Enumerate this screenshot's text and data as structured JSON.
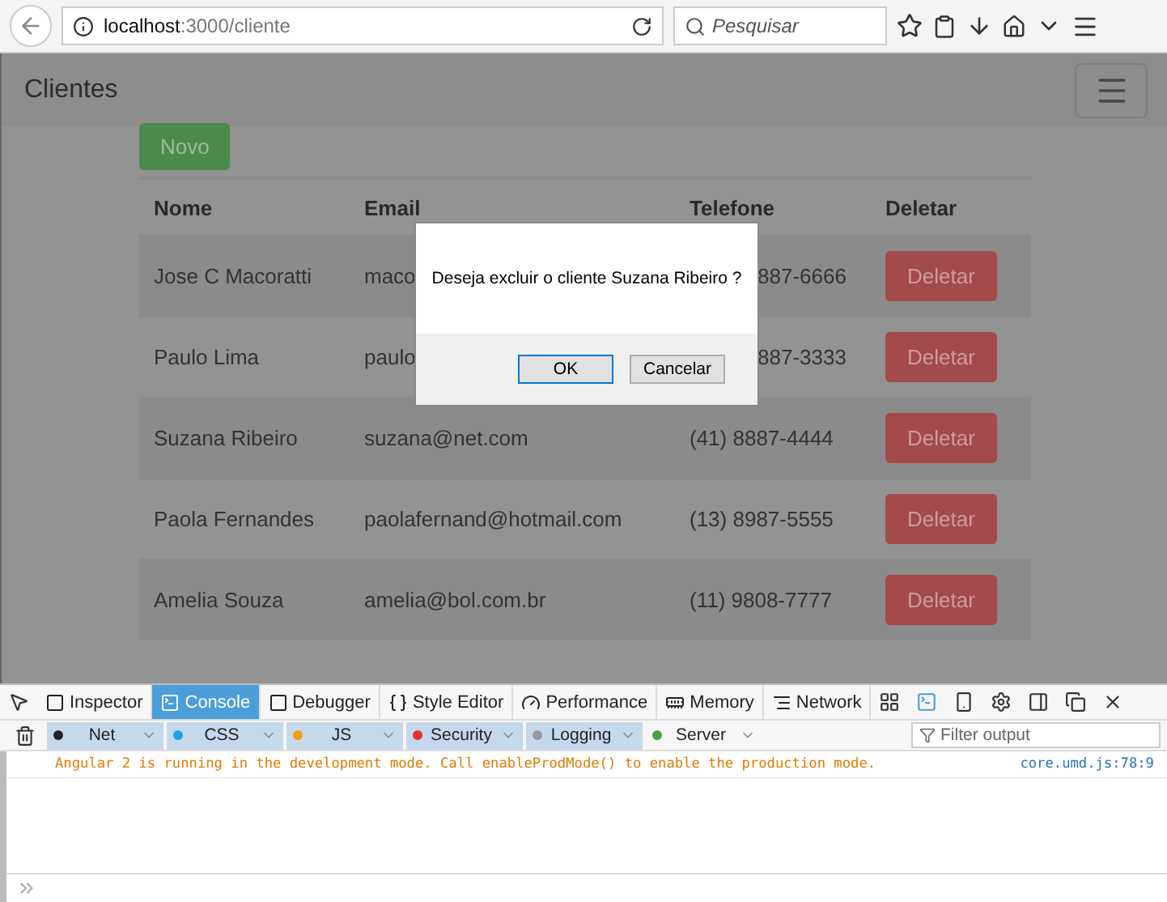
{
  "browser": {
    "url_host": "localhost",
    "url_path": ":3000/cliente",
    "search_placeholder": "Pesquisar"
  },
  "page": {
    "brand": "Clientes",
    "new_button": "Novo",
    "columns": [
      "Nome",
      "Email",
      "Telefone",
      "Deletar"
    ],
    "rows": [
      {
        "name": "Jose C Macoratti",
        "email": "maco",
        "phone": "887-6666",
        "action": "Deletar"
      },
      {
        "name": "Paulo Lima",
        "email": "paulo",
        "phone": "887-3333",
        "action": "Deletar"
      },
      {
        "name": "Suzana Ribeiro",
        "email": "suzana@net.com",
        "phone": "(41) 8887-4444",
        "action": "Deletar"
      },
      {
        "name": "Paola Fernandes",
        "email": "paolafernand@hotmail.com",
        "phone": "(13) 8987-5555",
        "action": "Deletar"
      },
      {
        "name": "Amelia Souza",
        "email": "amelia@bol.com.br",
        "phone": "(11) 9808-7777",
        "action": "Deletar"
      }
    ]
  },
  "dialog": {
    "message": "Deseja excluir o cliente Suzana Ribeiro ?",
    "buttons": [
      "OK",
      "Cancelar"
    ]
  },
  "devtools": {
    "tabs": [
      {
        "label": "Inspector",
        "selected": false
      },
      {
        "label": "Console",
        "selected": true
      },
      {
        "label": "Debugger",
        "selected": false
      },
      {
        "label": "Style Editor",
        "selected": false
      },
      {
        "label": "Performance",
        "selected": false
      },
      {
        "label": "Memory",
        "selected": false
      },
      {
        "label": "Network",
        "selected": false
      }
    ],
    "filters": [
      {
        "label": "Net",
        "color": "#222222",
        "selected": true
      },
      {
        "label": "CSS",
        "color": "#1ba1e2",
        "selected": true
      },
      {
        "label": "JS",
        "color": "#f39c12",
        "selected": true
      },
      {
        "label": "Security",
        "color": "#e03030",
        "selected": true
      },
      {
        "label": "Logging",
        "color": "#999999",
        "selected": true
      },
      {
        "label": "Server",
        "color": "#4aa04a",
        "selected": false
      }
    ],
    "filter_placeholder": "Filter output",
    "messages": [
      {
        "text": "Angular 2 is running in the development mode. Call enableProdMode() to enable the production mode.",
        "source": "core.umd.js:78:9"
      }
    ]
  }
}
